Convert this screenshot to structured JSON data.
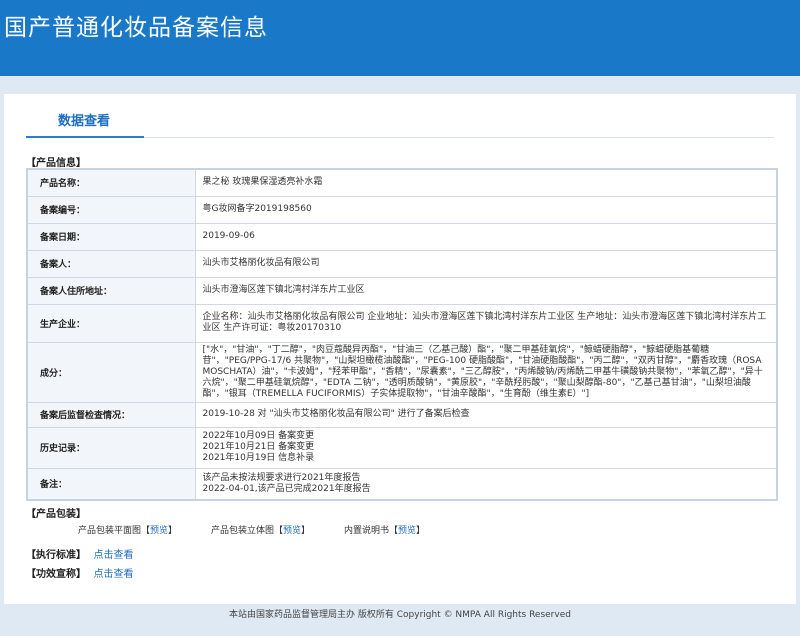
{
  "header": {
    "title": "国产普通化妆品备案信息"
  },
  "tab": {
    "label": "数据查看"
  },
  "product_section": {
    "title": "【产品信息】"
  },
  "product_info": {
    "rows": [
      {
        "label": "产品名称：",
        "value": "果之秘 玫瑰果保湿透亮补水霜"
      },
      {
        "label": "备案编号：",
        "value": "粤G妆网备字2019198560"
      },
      {
        "label": "备案日期：",
        "value": "2019-09-06"
      },
      {
        "label": "备案人：",
        "value": "汕头市艾格丽化妆品有限公司"
      },
      {
        "label": "备案人住所地址：",
        "value": "汕头市澄海区莲下镇北湾村洋东片工业区"
      },
      {
        "label": "生产企业：",
        "value": "企业名称：汕头市艾格丽化妆品有限公司 企业地址：汕头市澄海区莲下镇北湾村洋东片工业区 生产地址：汕头市澄海区莲下镇北湾村洋东片工业区 生产许可证：粤妆20170310"
      },
      {
        "label": "成分：",
        "value": "[\"水\"，\"甘油\"，\"丁二醇\"，\"肉豆蔻酸异丙酯\"，\"甘油三（乙基己酸）酯\"，\"聚二甲基硅氧烷\"，\"鲸蜡硬脂醇\"，\"鲸蜡硬脂基葡糖苷\"，\"PEG/PPG-17/6 共聚物\"，\"山梨坦橄榄油酸酯\"，\"PEG-100 硬脂酸酯\"，\"甘油硬脂酸酯\"，\"丙二醇\"，\"双丙甘醇\"，\"麝香玫瑰（ROSA MOSCHATA）油\"，\"卡波姆\"，\"羟苯甲酯\"，\"香精\"，\"尿囊素\"，\"三乙醇胺\"，\"丙烯酸钠/丙烯酰二甲基牛磺酸钠共聚物\"，\"苯氧乙醇\"，\"异十六烷\"，\"聚二甲基硅氧烷醇\"，\"EDTA 二钠\"，\"透明质酸钠\"，\"黄原胶\"，\"辛酰羟肟酸\"，\"聚山梨醇酯-80\"，\"乙基己基甘油\"，\"山梨坦油酸酯\"，\"银耳（TREMELLA FUCIFORMIS）子实体提取物\"，\"甘油辛酸酯\"，\"生育酚（维生素E）\"]"
      },
      {
        "label": "备案后监督检查情况：",
        "value": "2019-10-28 对 \"汕头市艾格丽化妆品有限公司\" 进行了备案后检查"
      },
      {
        "label": "历史记录：",
        "lines": [
          "2022年10月09日 备案变更",
          "2021年10月21日 备案变更",
          "2021年10月19日 信息补录"
        ]
      },
      {
        "label": "备注：",
        "lines": [
          "该产品未按法规要求进行2021年度报告",
          "2022-04-01,该产品已完成2021年度报告"
        ]
      }
    ]
  },
  "package_section": {
    "title": "【产品包装】",
    "items": [
      {
        "label": "产品包装平面图",
        "link": "预览"
      },
      {
        "label": "产品包装立体图",
        "link": "预览"
      },
      {
        "label": "内置说明书",
        "link": "预览"
      }
    ]
  },
  "standard_section": {
    "title": "【执行标准】",
    "link": "点击查看"
  },
  "efficacy_section": {
    "title": "【功效宣称】",
    "link": "点击查看"
  },
  "footer": {
    "text": "本站由国家药品监督管理局主办 版权所有 Copyright © NMPA All Rights Reserved"
  },
  "colors": {
    "header_bg": "#1a78c9",
    "link": "#1f6fc0",
    "page_bg": "#dfe9f3"
  }
}
